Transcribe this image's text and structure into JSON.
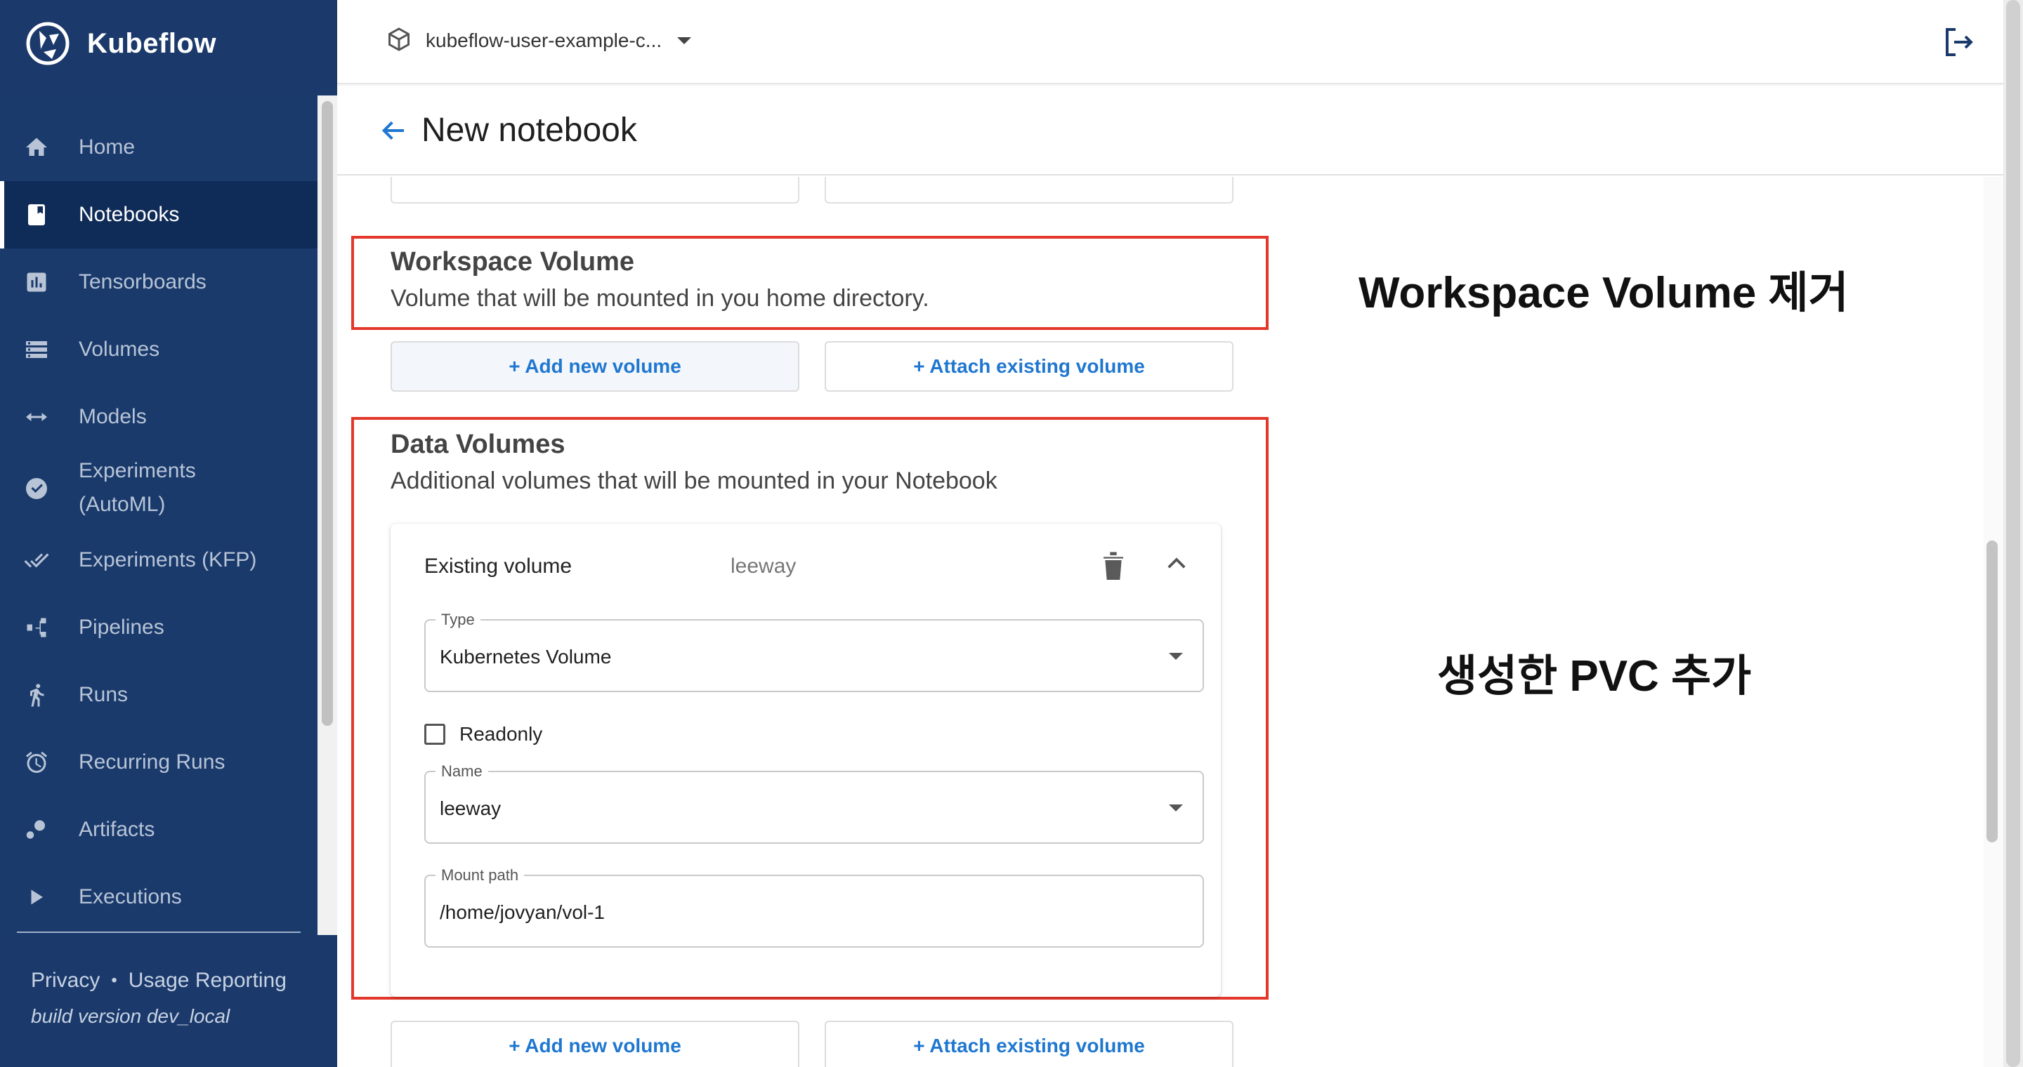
{
  "app": {
    "brand_name": "Kubeflow"
  },
  "sidebar": {
    "items": [
      {
        "label": "Home",
        "icon": "home-icon",
        "active": false
      },
      {
        "label": "Notebooks",
        "icon": "notebook-icon",
        "active": true
      },
      {
        "label": "Tensorboards",
        "icon": "tensorboard-icon",
        "active": false
      },
      {
        "label": "Volumes",
        "icon": "volumes-icon",
        "active": false
      },
      {
        "label": "Models",
        "icon": "models-icon",
        "active": false
      },
      {
        "label": "Experiments",
        "label2": "(AutoML)",
        "icon": "automl-icon",
        "active": false
      },
      {
        "label": "Experiments (KFP)",
        "icon": "kfp-experiments-icon",
        "active": false
      },
      {
        "label": "Pipelines",
        "icon": "pipelines-icon",
        "active": false
      },
      {
        "label": "Runs",
        "icon": "runs-icon",
        "active": false
      },
      {
        "label": "Recurring Runs",
        "icon": "recurring-runs-icon",
        "active": false
      },
      {
        "label": "Artifacts",
        "icon": "artifacts-icon",
        "active": false
      },
      {
        "label": "Executions",
        "icon": "executions-icon",
        "active": false
      }
    ],
    "footer": {
      "privacy": "Privacy",
      "dot": "•",
      "usage": "Usage Reporting",
      "build": "build version dev_local"
    }
  },
  "topbar": {
    "namespace": "kubeflow-user-example-c..."
  },
  "page": {
    "title": "New notebook"
  },
  "workspace": {
    "title": "Workspace Volume",
    "subtitle": "Volume that will be mounted in you home directory.",
    "add_button": "+ Add new volume",
    "attach_button": "+ Attach existing volume"
  },
  "data_volumes": {
    "title": "Data Volumes",
    "subtitle": "Additional volumes that will be mounted in your Notebook",
    "card": {
      "kind": "Existing volume",
      "name_value": "leeway",
      "type_label": "Type",
      "type_value": "Kubernetes Volume",
      "readonly_label": "Readonly",
      "name_label": "Name",
      "name_field_value": "leeway",
      "mount_label": "Mount path",
      "mount_value": "/home/jovyan/vol-1"
    },
    "add_button": "+ Add new volume",
    "attach_button": "+ Attach existing volume"
  },
  "annotations": {
    "workspace_note": "Workspace Volume  제거",
    "pvc_note": "생성한 PVC 추가"
  },
  "colors": {
    "sidebar": "#1b3a6b",
    "accent": "#1f77d0",
    "highlight": "#e2372a"
  }
}
